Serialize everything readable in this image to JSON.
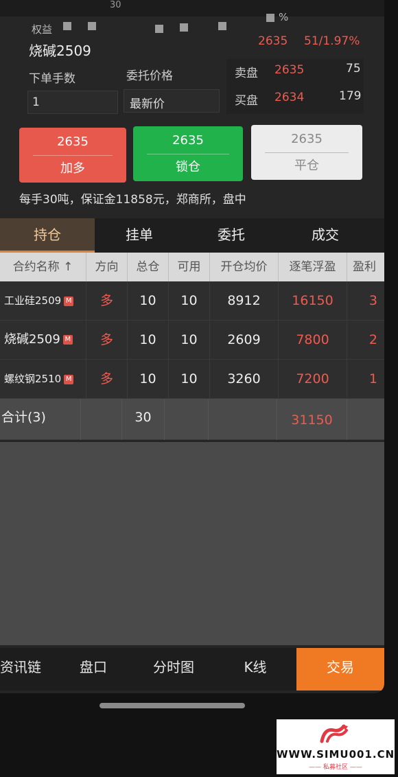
{
  "status_bar": {
    "partial_text": "30"
  },
  "header": {
    "equity_label": "权益",
    "percent_sign": "%",
    "contract_name": "烧碱2509",
    "last_price": "2635",
    "change": "51/1.97%"
  },
  "order_form": {
    "qty_label": "下单手数",
    "price_label": "委托价格",
    "qty_value": "1",
    "price_value": "最新价"
  },
  "order_book": {
    "ask_label": "卖盘",
    "ask_price": "2635",
    "ask_volume": "75",
    "bid_label": "买盘",
    "bid_price": "2634",
    "bid_volume": "179"
  },
  "actions": [
    {
      "price": "2635",
      "label": "加多"
    },
    {
      "price": "2635",
      "label": "锁仓"
    },
    {
      "price": "2635",
      "label": "平仓"
    }
  ],
  "contract_info": "每手30吨，保证金11858元，郑商所，盘中",
  "tabs": [
    "持仓",
    "挂单",
    "委托",
    "成交"
  ],
  "table": {
    "headers": [
      "合约名称 ↑",
      "方向",
      "总仓",
      "可用",
      "开仓均价",
      "逐笔浮盈",
      "盈利"
    ],
    "rows": [
      {
        "name": "工业硅2509",
        "badge": "M",
        "direction": "多",
        "total": "10",
        "available": "10",
        "avg_price": "8912",
        "float_pnl": "16150",
        "profit": "3"
      },
      {
        "name": "烧碱2509",
        "badge": "M",
        "direction": "多",
        "total": "10",
        "available": "10",
        "avg_price": "2609",
        "float_pnl": "7800",
        "profit": "2"
      },
      {
        "name": "螺纹钢2510",
        "badge": "M",
        "direction": "多",
        "total": "10",
        "available": "10",
        "avg_price": "3260",
        "float_pnl": "7200",
        "profit": "1"
      }
    ],
    "total": {
      "label": "合计(3)",
      "total": "30",
      "float_pnl": "31150"
    }
  },
  "bottom_nav": [
    "资讯链",
    "盘口",
    "分时图",
    "K线",
    "交易"
  ],
  "watermark": {
    "site": "WWW.SIMU001.CN",
    "sub": "—— 私募社区 ——"
  },
  "colors": {
    "up": "#f05a4f",
    "buy": "#e8594d",
    "lock": "#21b24b",
    "accent": "#f07a23"
  }
}
